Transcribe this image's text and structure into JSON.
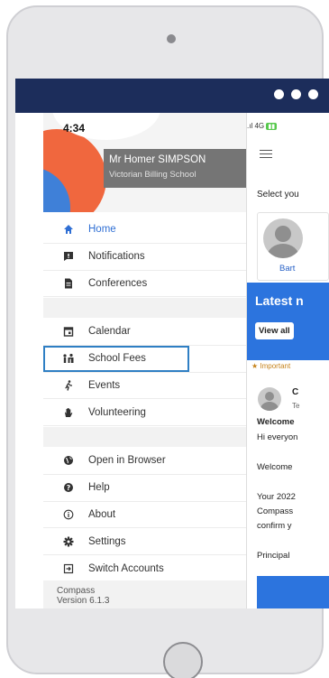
{
  "topbar": {
    "more_label": "• • •"
  },
  "drawer": {
    "time": "4:34",
    "user_name": "Mr Homer SIMPSON",
    "school_name": "Victorian Billing School",
    "section1": [
      {
        "label": "Home",
        "icon": "home-icon"
      },
      {
        "label": "Notifications",
        "icon": "notification-icon"
      },
      {
        "label": "Conferences",
        "icon": "document-icon"
      }
    ],
    "section2": [
      {
        "label": "Calendar",
        "icon": "calendar-icon"
      },
      {
        "label": "School Fees",
        "icon": "school-fees-icon"
      },
      {
        "label": "Events",
        "icon": "running-person-icon"
      },
      {
        "label": "Volunteering",
        "icon": "hand-icon"
      }
    ],
    "section3": [
      {
        "label": "Open in Browser",
        "icon": "globe-icon"
      },
      {
        "label": "Help",
        "icon": "help-icon"
      },
      {
        "label": "About",
        "icon": "info-icon"
      },
      {
        "label": "Settings",
        "icon": "gear-icon"
      },
      {
        "label": "Switch Accounts",
        "icon": "switch-accounts-icon"
      }
    ],
    "footer_app": "Compass",
    "footer_version": "Version 6.1.3"
  },
  "background_app": {
    "status_signal": "4G",
    "select_label": "Select you",
    "student_name": "Bart",
    "latest_title": "Latest n",
    "view_all": "View all",
    "important": "★ Important",
    "post_initial": "C",
    "post_sub": "Te",
    "lines": {
      "welcome_bold": "Welcome",
      "hi": "Hi everyon",
      "welcome2": "Welcome",
      "your": "Your 2022",
      "compass": "Compass",
      "confirm": "confirm y",
      "principal": "Principal"
    }
  },
  "colors": {
    "topbar": "#1c2d5b",
    "accent": "#2f6fd4",
    "highlight_border": "#2f7fc4"
  }
}
